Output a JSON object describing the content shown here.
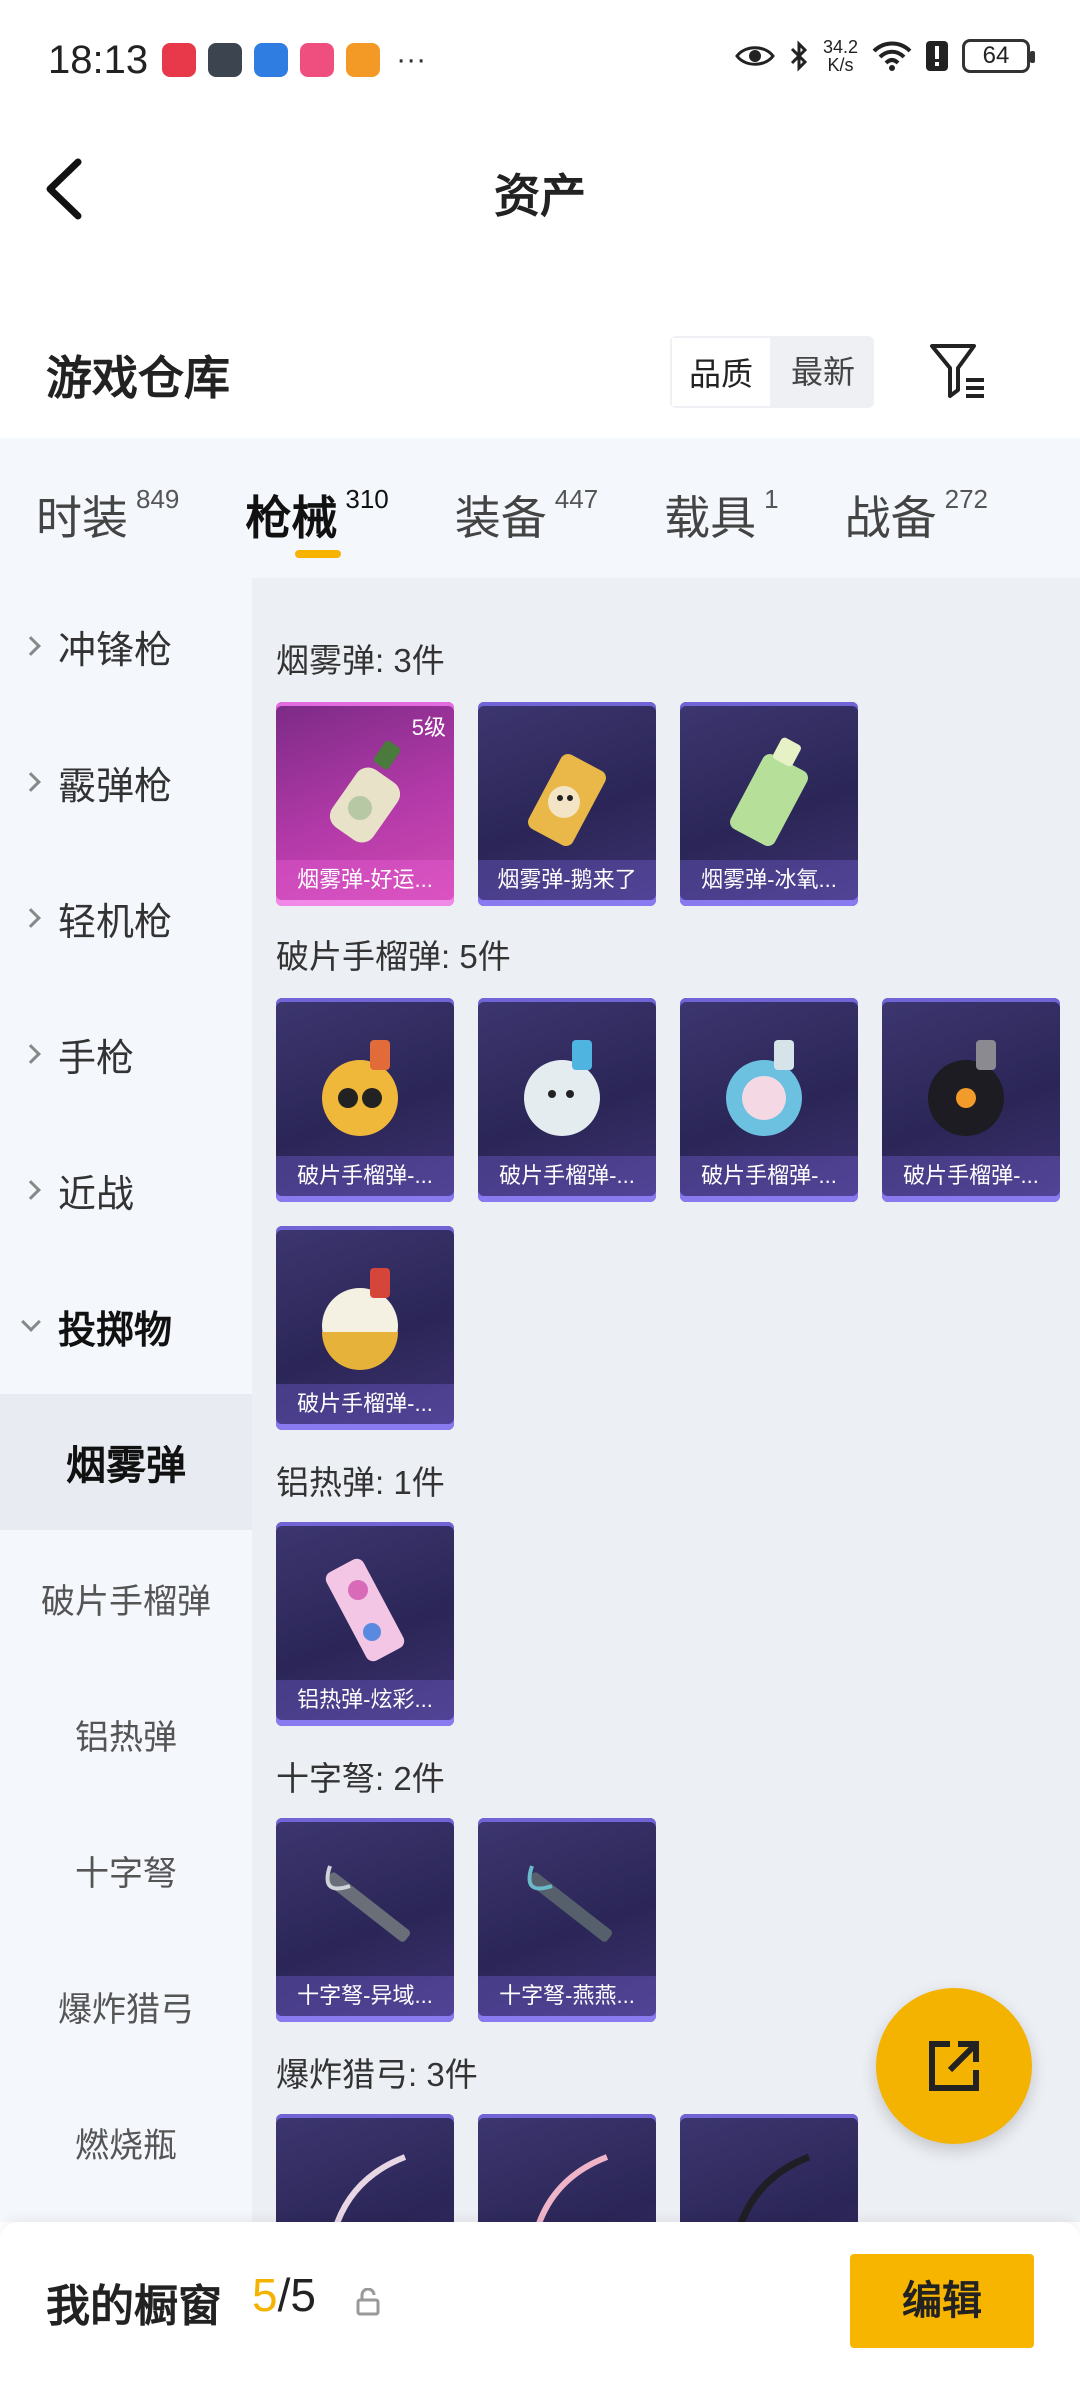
{
  "status_bar": {
    "time": "18:13",
    "net_speed_value": "34.2",
    "net_speed_unit": "K/s",
    "battery": "64",
    "dots": "···"
  },
  "nav": {
    "title": "资产"
  },
  "warehouse": {
    "title": "游戏仓库",
    "sort_quality": "品质",
    "sort_latest": "最新"
  },
  "category_tabs": [
    {
      "label": "时装",
      "count": "849"
    },
    {
      "label": "枪械",
      "count": "310"
    },
    {
      "label": "装备",
      "count": "447"
    },
    {
      "label": "载具",
      "count": "1"
    },
    {
      "label": "战备",
      "count": "272"
    }
  ],
  "sidebar": {
    "items": [
      {
        "label": "冲锋枪"
      },
      {
        "label": "霰弹枪"
      },
      {
        "label": "轻机枪"
      },
      {
        "label": "手枪"
      },
      {
        "label": "近战"
      },
      {
        "label": "投掷物"
      }
    ],
    "subitems": [
      {
        "label": "烟雾弹"
      },
      {
        "label": "破片手榴弹"
      },
      {
        "label": "铝热弹"
      },
      {
        "label": "十字弩"
      },
      {
        "label": "爆炸猎弓"
      },
      {
        "label": "燃烧瓶"
      }
    ]
  },
  "groups": [
    {
      "title": "烟雾弹: 3件",
      "items": [
        {
          "label": "烟雾弹-好运...",
          "level": "5级",
          "rarity": "pink"
        },
        {
          "label": "烟雾弹-鹅来了",
          "rarity": "purple"
        },
        {
          "label": "烟雾弹-冰氧...",
          "rarity": "purple"
        }
      ]
    },
    {
      "title": "破片手榴弹: 5件",
      "items": [
        {
          "label": "破片手榴弹-...",
          "rarity": "purple"
        },
        {
          "label": "破片手榴弹-...",
          "rarity": "purple"
        },
        {
          "label": "破片手榴弹-...",
          "rarity": "purple"
        },
        {
          "label": "破片手榴弹-...",
          "rarity": "purple"
        },
        {
          "label": "破片手榴弹-...",
          "rarity": "purple"
        }
      ]
    },
    {
      "title": "铝热弹: 1件",
      "items": [
        {
          "label": "铝热弹-炫彩...",
          "rarity": "purple"
        }
      ]
    },
    {
      "title": "十字弩: 2件",
      "items": [
        {
          "label": "十字弩-异域...",
          "rarity": "purple"
        },
        {
          "label": "十字弩-燕燕...",
          "rarity": "purple"
        }
      ]
    },
    {
      "title": "爆炸猎弓: 3件",
      "items": [
        {
          "label": "",
          "rarity": "purple"
        },
        {
          "label": "",
          "rarity": "purple"
        },
        {
          "label": "",
          "rarity": "purple"
        }
      ]
    }
  ],
  "bottom": {
    "showcase_label": "我的橱窗",
    "showcase_current": "5",
    "showcase_sep": "/",
    "showcase_total": "5",
    "edit_label": "编辑"
  },
  "colors": {
    "accent": "#f5b301",
    "card_purple": "#2b2657",
    "card_pink": "#b43aa9"
  }
}
